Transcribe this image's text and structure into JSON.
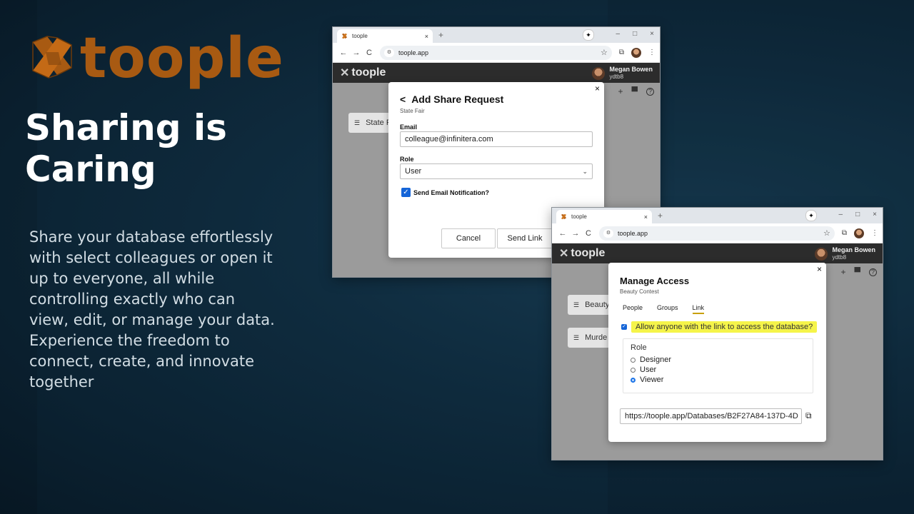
{
  "brand": {
    "name": "toople"
  },
  "headline": {
    "line1": "Sharing is",
    "line2": "Caring"
  },
  "blurb": "Share your database effortlessly with select colleagues or open it up to everyone, all while controlling exactly who can view, edit, or manage your data. Experience the freedom to connect, create, and innovate together",
  "colors": {
    "brand_orange": "#a85a12",
    "background": "#0f2c3f",
    "accent_blue": "#1565d8",
    "highlight_yellow": "#f5f44a"
  },
  "window1": {
    "tab_title": "toople",
    "url": "toople.app",
    "app_name": "toople",
    "user": {
      "name": "Megan Bowen",
      "id": "ydtb8"
    },
    "db_card": "State F",
    "modal": {
      "back": "<",
      "title": "Add Share Request",
      "subtitle": "State Fair",
      "close": "×",
      "email_label": "Email",
      "email_value": "colleague@infinitera.com",
      "role_label": "Role",
      "role_value": "User",
      "notify_label": "Send Email Notification?",
      "notify_checked": true,
      "cancel_label": "Cancel",
      "send_label": "Send Link"
    }
  },
  "window2": {
    "tab_title": "toople",
    "url": "toople.app",
    "app_name": "toople",
    "user": {
      "name": "Megan Bowen",
      "id": "ydtb8"
    },
    "db_cards": [
      "Beauty",
      "Murde"
    ],
    "modal": {
      "title": "Manage Access",
      "subtitle": "Beauty Contest",
      "close": "×",
      "tabs": [
        "People",
        "Groups",
        "Link"
      ],
      "active_tab": "Link",
      "allow_label": "Allow anyone with the link to access the database?",
      "allow_checked": true,
      "role_legend": "Role",
      "roles": [
        "Designer",
        "User",
        "Viewer"
      ],
      "selected_role": "Viewer",
      "link_value": "https://toople.app/Databases/B2F27A84-137D-4D"
    }
  },
  "icons": {
    "tab_close": "×",
    "new_tab": "+",
    "back": "←",
    "forward": "→",
    "reload": "C",
    "bookmark": "☆",
    "minimize": "–",
    "maximize": "□",
    "close_win": "×",
    "menu": "⋮",
    "add": "+",
    "cart": "🛒",
    "help": "?",
    "copy": "⧉"
  }
}
